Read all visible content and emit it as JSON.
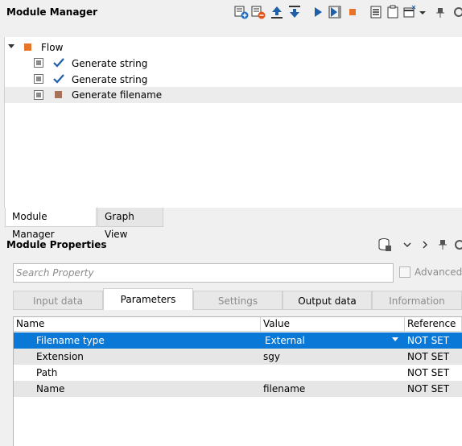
{
  "module_manager": {
    "title": "Module Manager",
    "toolbar_icons": [
      "add-module-icon",
      "remove-module-icon",
      "move-up-icon",
      "move-down-icon",
      "run-icon",
      "run-step-icon",
      "stop-icon",
      "list-icon",
      "clipboard-icon",
      "window-icon",
      "chevron-down-icon",
      "pin-icon"
    ],
    "tree": {
      "root": "Flow",
      "items": [
        {
          "label": "Generate string",
          "status": "check"
        },
        {
          "label": "Generate string",
          "status": "check"
        },
        {
          "label": "Generate filename",
          "status": "square"
        }
      ]
    },
    "tabs": [
      "Module Manager",
      "Graph View"
    ]
  },
  "module_properties": {
    "title": "Module Properties",
    "search_placeholder": "Search Property",
    "advanced_label": "Advanced",
    "tabs": [
      "Input data",
      "Parameters",
      "Settings",
      "Output data",
      "Information"
    ],
    "active_tab": "Parameters",
    "columns": [
      "Name",
      "Value",
      "Reference"
    ],
    "rows": [
      {
        "name": "Filename type",
        "value": "External",
        "reference": "NOT SET"
      },
      {
        "name": "Extension",
        "value": "sgy",
        "reference": "NOT SET"
      },
      {
        "name": "Path",
        "value": "",
        "reference": "NOT SET"
      },
      {
        "name": "Name",
        "value": "filename",
        "reference": "NOT SET"
      }
    ]
  },
  "colors": {
    "accent": "#0a78d7",
    "flow_icon": "#e8742a",
    "check": "#1f5fa8",
    "module_square": "#a8715a"
  }
}
